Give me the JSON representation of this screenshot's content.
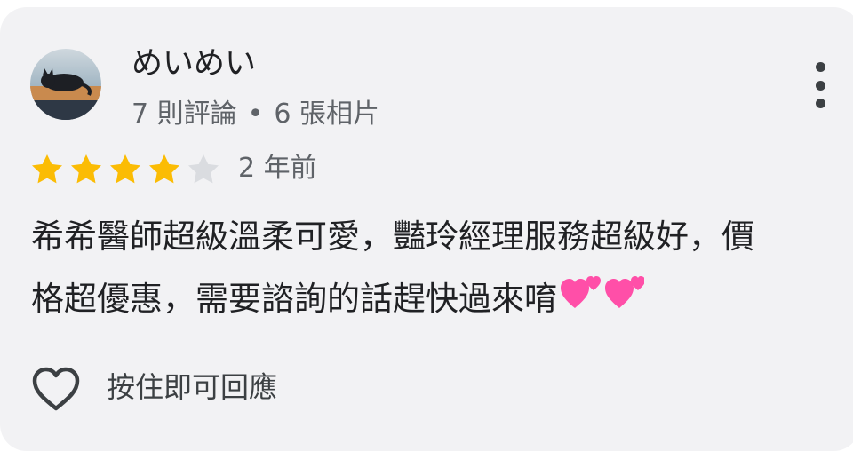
{
  "review": {
    "author": {
      "name": "めいめい",
      "review_count_text": "7 則評論",
      "separator": "•",
      "photo_count_text": "6 張相片"
    },
    "rating": 4,
    "rating_max": 5,
    "time_text": "2 年前",
    "text_line1": "希希醫師超級溫柔可愛，豔玲經理服務超級好，價",
    "text_line2": "格超優惠，需要諮詢的話趕快過來唷",
    "emoji": "two-hearts-emoji"
  },
  "actions": {
    "like_icon": "heart-outline-icon",
    "reply_label": "按住即可回應",
    "more_icon": "more-vert-icon"
  },
  "colors": {
    "card_background": "#f2f2f4",
    "star_filled": "#fbbc04",
    "star_empty": "#dadce0",
    "emoji_pink": "#ff4fa8"
  }
}
